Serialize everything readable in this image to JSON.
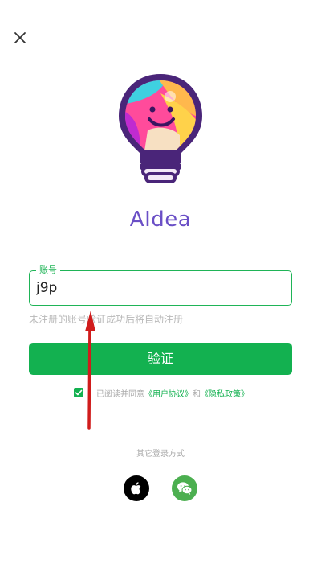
{
  "app": {
    "name": "AIdea"
  },
  "login": {
    "account_label": "账号",
    "account_value": "j9p",
    "hint": "未注册的账号验证成功后将自动注册",
    "verify_button": "验证",
    "agree_prefix": "已阅读并同意",
    "user_agreement": "《用户协议》",
    "and": "和",
    "privacy_policy": "《隐私政策》",
    "agreed": true
  },
  "other_login": {
    "title": "其它登录方式",
    "options": [
      "apple-icon",
      "wechat-icon"
    ]
  },
  "colors": {
    "accent": "#13b150",
    "brand_text": "#6a4fc6",
    "annotation_arrow": "#d01c1c"
  }
}
